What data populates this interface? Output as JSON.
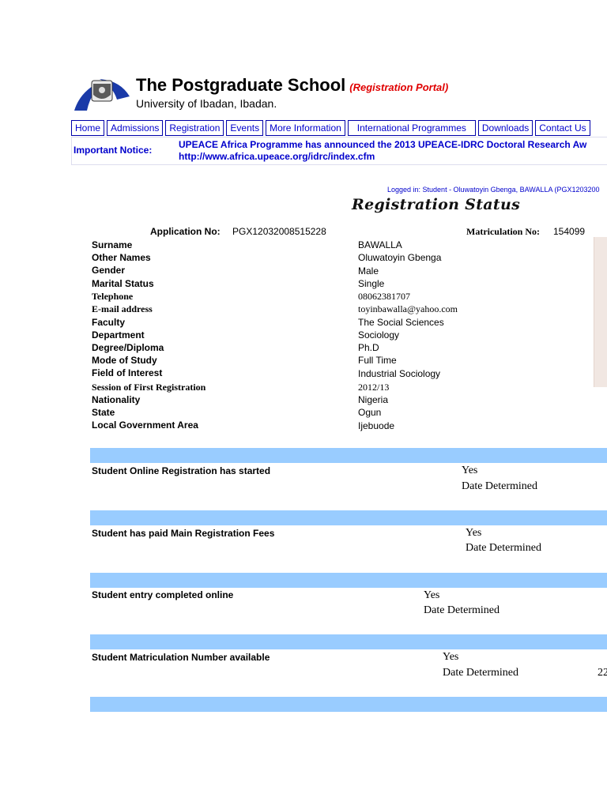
{
  "header": {
    "title": "The Postgraduate School",
    "tagline": "(Registration Portal)",
    "subtitle": "University of Ibadan, Ibadan."
  },
  "nav": [
    "Home",
    "Admissions",
    "Registration",
    "Events",
    "More Information",
    "International Programmes",
    "Downloads",
    "Contact Us"
  ],
  "notice": {
    "label": "Important Notice:",
    "line1": "UPEACE Africa Programme has announced the 2013 UPEACE-IDRC Doctoral Research Aw",
    "line2": "http://www.africa.upeace.org/idrc/index.cfm"
  },
  "logged_in": "Logged in: Student - Oluwatoyin Gbenga, BAWALLA (PGX1203200",
  "page_title": "Registration Status",
  "application": {
    "label": "Application No:",
    "value": "PGX12032008515228"
  },
  "matriculation": {
    "label": "Matriculation No:",
    "value": "154099"
  },
  "details": [
    {
      "label": "Surname",
      "value": "BAWALLA"
    },
    {
      "label": "Other Names",
      "value": "Oluwatoyin Gbenga"
    },
    {
      "label": "Gender",
      "value": "Male"
    },
    {
      "label": "Marital Status",
      "value": "Single"
    },
    {
      "label": "Telephone",
      "value": "08062381707"
    },
    {
      "label": "E-mail address",
      "value": "toyinbawalla@yahoo.com"
    },
    {
      "label": "Faculty",
      "value": "The Social Sciences"
    },
    {
      "label": "Department",
      "value": "Sociology"
    },
    {
      "label": "Degree/Diploma",
      "value": "Ph.D"
    },
    {
      "label": "Mode of Study",
      "value": "Full Time"
    },
    {
      "label": "Field of Interest",
      "value": "Industrial Sociology"
    },
    {
      "label": "Session of First Registration",
      "value": "2012/13"
    },
    {
      "label": "Nationality",
      "value": "Nigeria"
    },
    {
      "label": "State",
      "value": "Ogun"
    },
    {
      "label": "Local Government Area",
      "value": "Ijebuode"
    }
  ],
  "steps": [
    {
      "label": "Student Online Registration has started",
      "status": "Yes",
      "date_label": "Date Determined",
      "date": ""
    },
    {
      "label": "Student has paid Main Registration Fees",
      "status": "Yes",
      "date_label": "Date Determined",
      "date": ""
    },
    {
      "label": "Student entry completed online",
      "status": "Yes",
      "date_label": "Date Determined",
      "date": ""
    },
    {
      "label": "Student Matriculation Number available",
      "status": "Yes",
      "date_label": "Date Determined",
      "date": "22"
    }
  ],
  "colors": {
    "link": "#0000cc",
    "bar": "#99ccff",
    "tag": "#e00000"
  }
}
